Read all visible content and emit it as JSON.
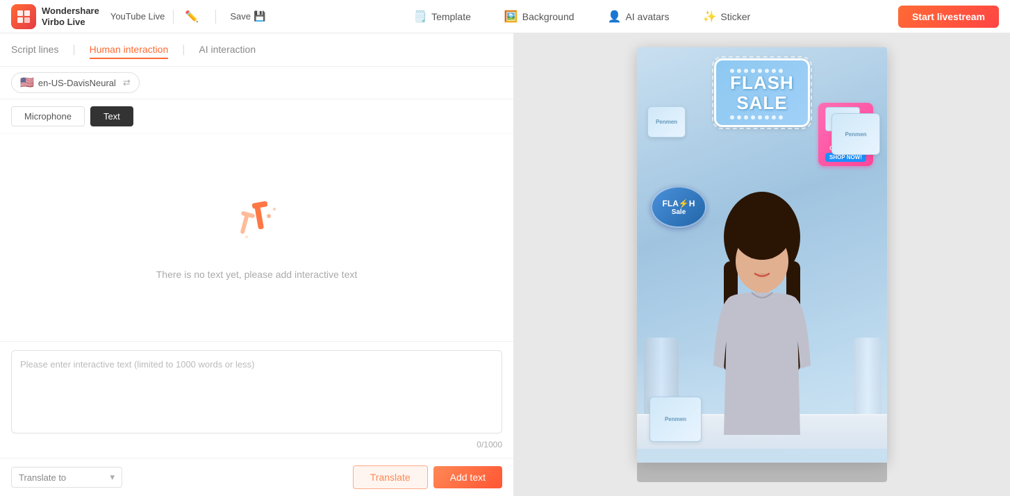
{
  "app": {
    "logo_text": "Wondershare\nVirbo Live",
    "platform": "YouTube Live",
    "save_label": "Save",
    "start_livestream_label": "Start livestream"
  },
  "header_nav": {
    "template_label": "Template",
    "background_label": "Background",
    "ai_avatars_label": "AI avatars",
    "sticker_label": "Sticker"
  },
  "left_panel": {
    "tab_script_lines": "Script lines",
    "tab_human_interaction": "Human interaction",
    "tab_ai_interaction": "AI interaction",
    "active_tab": "Human interaction",
    "language": "en-US-DavisNeural",
    "flag": "🇺🇸",
    "btn_microphone": "Microphone",
    "btn_text": "Text",
    "active_input": "Text",
    "empty_state_text": "There is no text yet, please add interactive text",
    "text_input_placeholder": "Please enter interactive text (limited to 1000 words or less)",
    "char_count": "0/1000",
    "translate_to_label": "Translate to",
    "translate_btn": "Translate",
    "add_text_btn": "Add text"
  },
  "right_panel": {
    "preview_title": "Flash Sale",
    "preview_subtitle": "BUY 1\nGET 1 FREE\nSHOP NOW!",
    "flash_sale_oval_line1": "FLA⚡H",
    "flash_sale_oval_line2": "Sale"
  }
}
